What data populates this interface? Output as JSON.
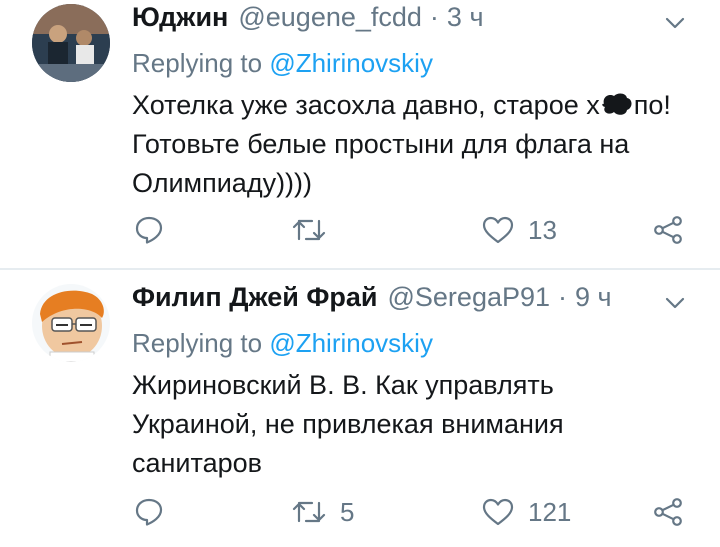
{
  "tweets": [
    {
      "name": "Юджин",
      "handle": "@eugene_fcdd",
      "separator": "·",
      "time": "3 ч",
      "replying_prefix": "Replying to",
      "replying_to": "@Zhirinovskiy",
      "text_lines": [
        "Хотелка уже засохла давно, старое х",
        "по!",
        "Готовьте белые простыни для флага на",
        "Олимпиаду))))"
      ],
      "replies": "",
      "retweets": "",
      "likes": "13"
    },
    {
      "name": "Филип Джей Фрай",
      "handle": "@SeregaP91",
      "separator": "·",
      "time": "9 ч",
      "replying_prefix": "Replying to",
      "replying_to": "@Zhirinovskiy",
      "text_lines": [
        "Жириновский В. В. Как управлять",
        "Украиной, не привлекая внимания",
        "санитаров"
      ],
      "replies": "",
      "retweets": "5",
      "likes": "121"
    }
  ],
  "colors": {
    "text": "#14171a",
    "secondary": "#657786",
    "link": "#1da1f2",
    "divider": "#e6ecf0"
  },
  "icons": [
    "reply-icon",
    "retweet-icon",
    "like-icon",
    "share-icon",
    "chevron-down-icon"
  ]
}
